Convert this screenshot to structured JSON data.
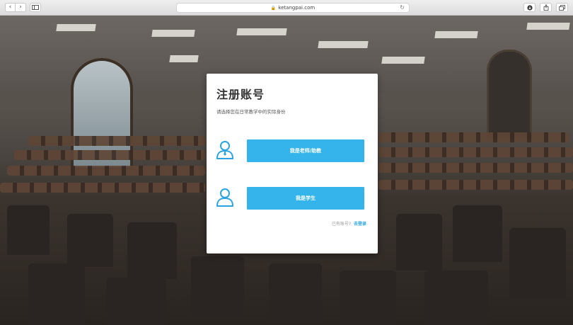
{
  "browser": {
    "address": "ketangpai.com",
    "icons": {
      "back": "chevron-left-icon",
      "forward": "chevron-right-icon",
      "sidebar": "sidebar-icon",
      "reload": "reload-icon",
      "download": "download-icon",
      "share": "share-icon",
      "tabs": "tabs-icon"
    }
  },
  "dialog": {
    "title": "注册账号",
    "subtitle": "请选择您在日常教学中的实际身份",
    "teacher_button": "我是老师/助教",
    "student_button": "我是学生",
    "has_account_text": "已有账号?",
    "login_link": "去登录"
  },
  "colors": {
    "accent": "#34b4ea",
    "link": "#2aa3e0",
    "icon": "#2aa3e0"
  }
}
